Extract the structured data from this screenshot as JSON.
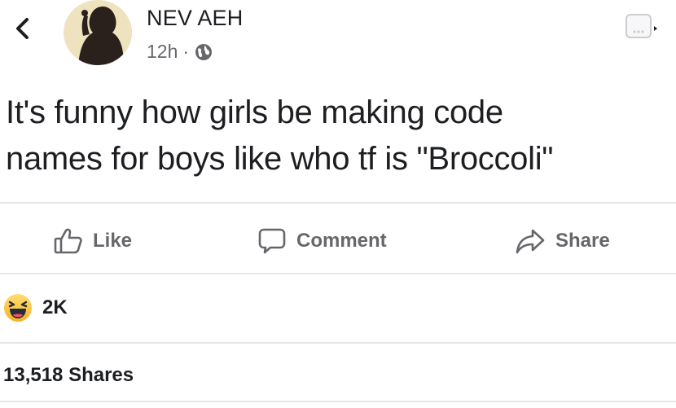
{
  "post": {
    "author": "NEV AEH",
    "time": "12h",
    "separator": "·",
    "privacy_icon": "globe-icon",
    "text_lines": [
      "It's funny how girls be making code",
      "names for boys like who tf is \"Broccoli\""
    ]
  },
  "actions": {
    "like_label": "Like",
    "comment_label": "Comment",
    "share_label": "Share"
  },
  "reactions": {
    "icon": "haha-emoji-icon",
    "count": "2K"
  },
  "shares_text": "13,518 Shares",
  "colors": {
    "text": "#1c1e21",
    "secondary": "#65676b",
    "divider": "#e4e6eb"
  }
}
